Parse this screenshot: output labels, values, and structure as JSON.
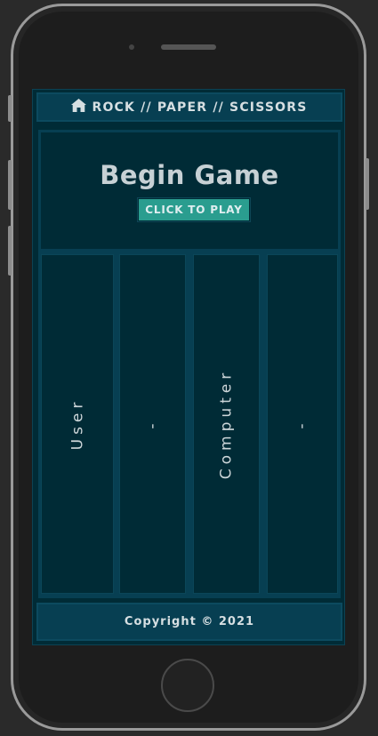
{
  "nav": {
    "icon": "home-icon",
    "title": "ROCK // PAPER // SCISSORS"
  },
  "hero": {
    "title": "Begin Game",
    "play_label": "CLICK TO PLAY"
  },
  "scoreboard": {
    "user_label": "User",
    "user_score": "-",
    "computer_label": "Computer",
    "computer_score": "-"
  },
  "footer": {
    "copyright": "Copyright © 2021"
  },
  "colors": {
    "background": "#002b36",
    "panel": "#073f52",
    "accent": "#2a9d8f",
    "text": "#d6dfe2"
  }
}
